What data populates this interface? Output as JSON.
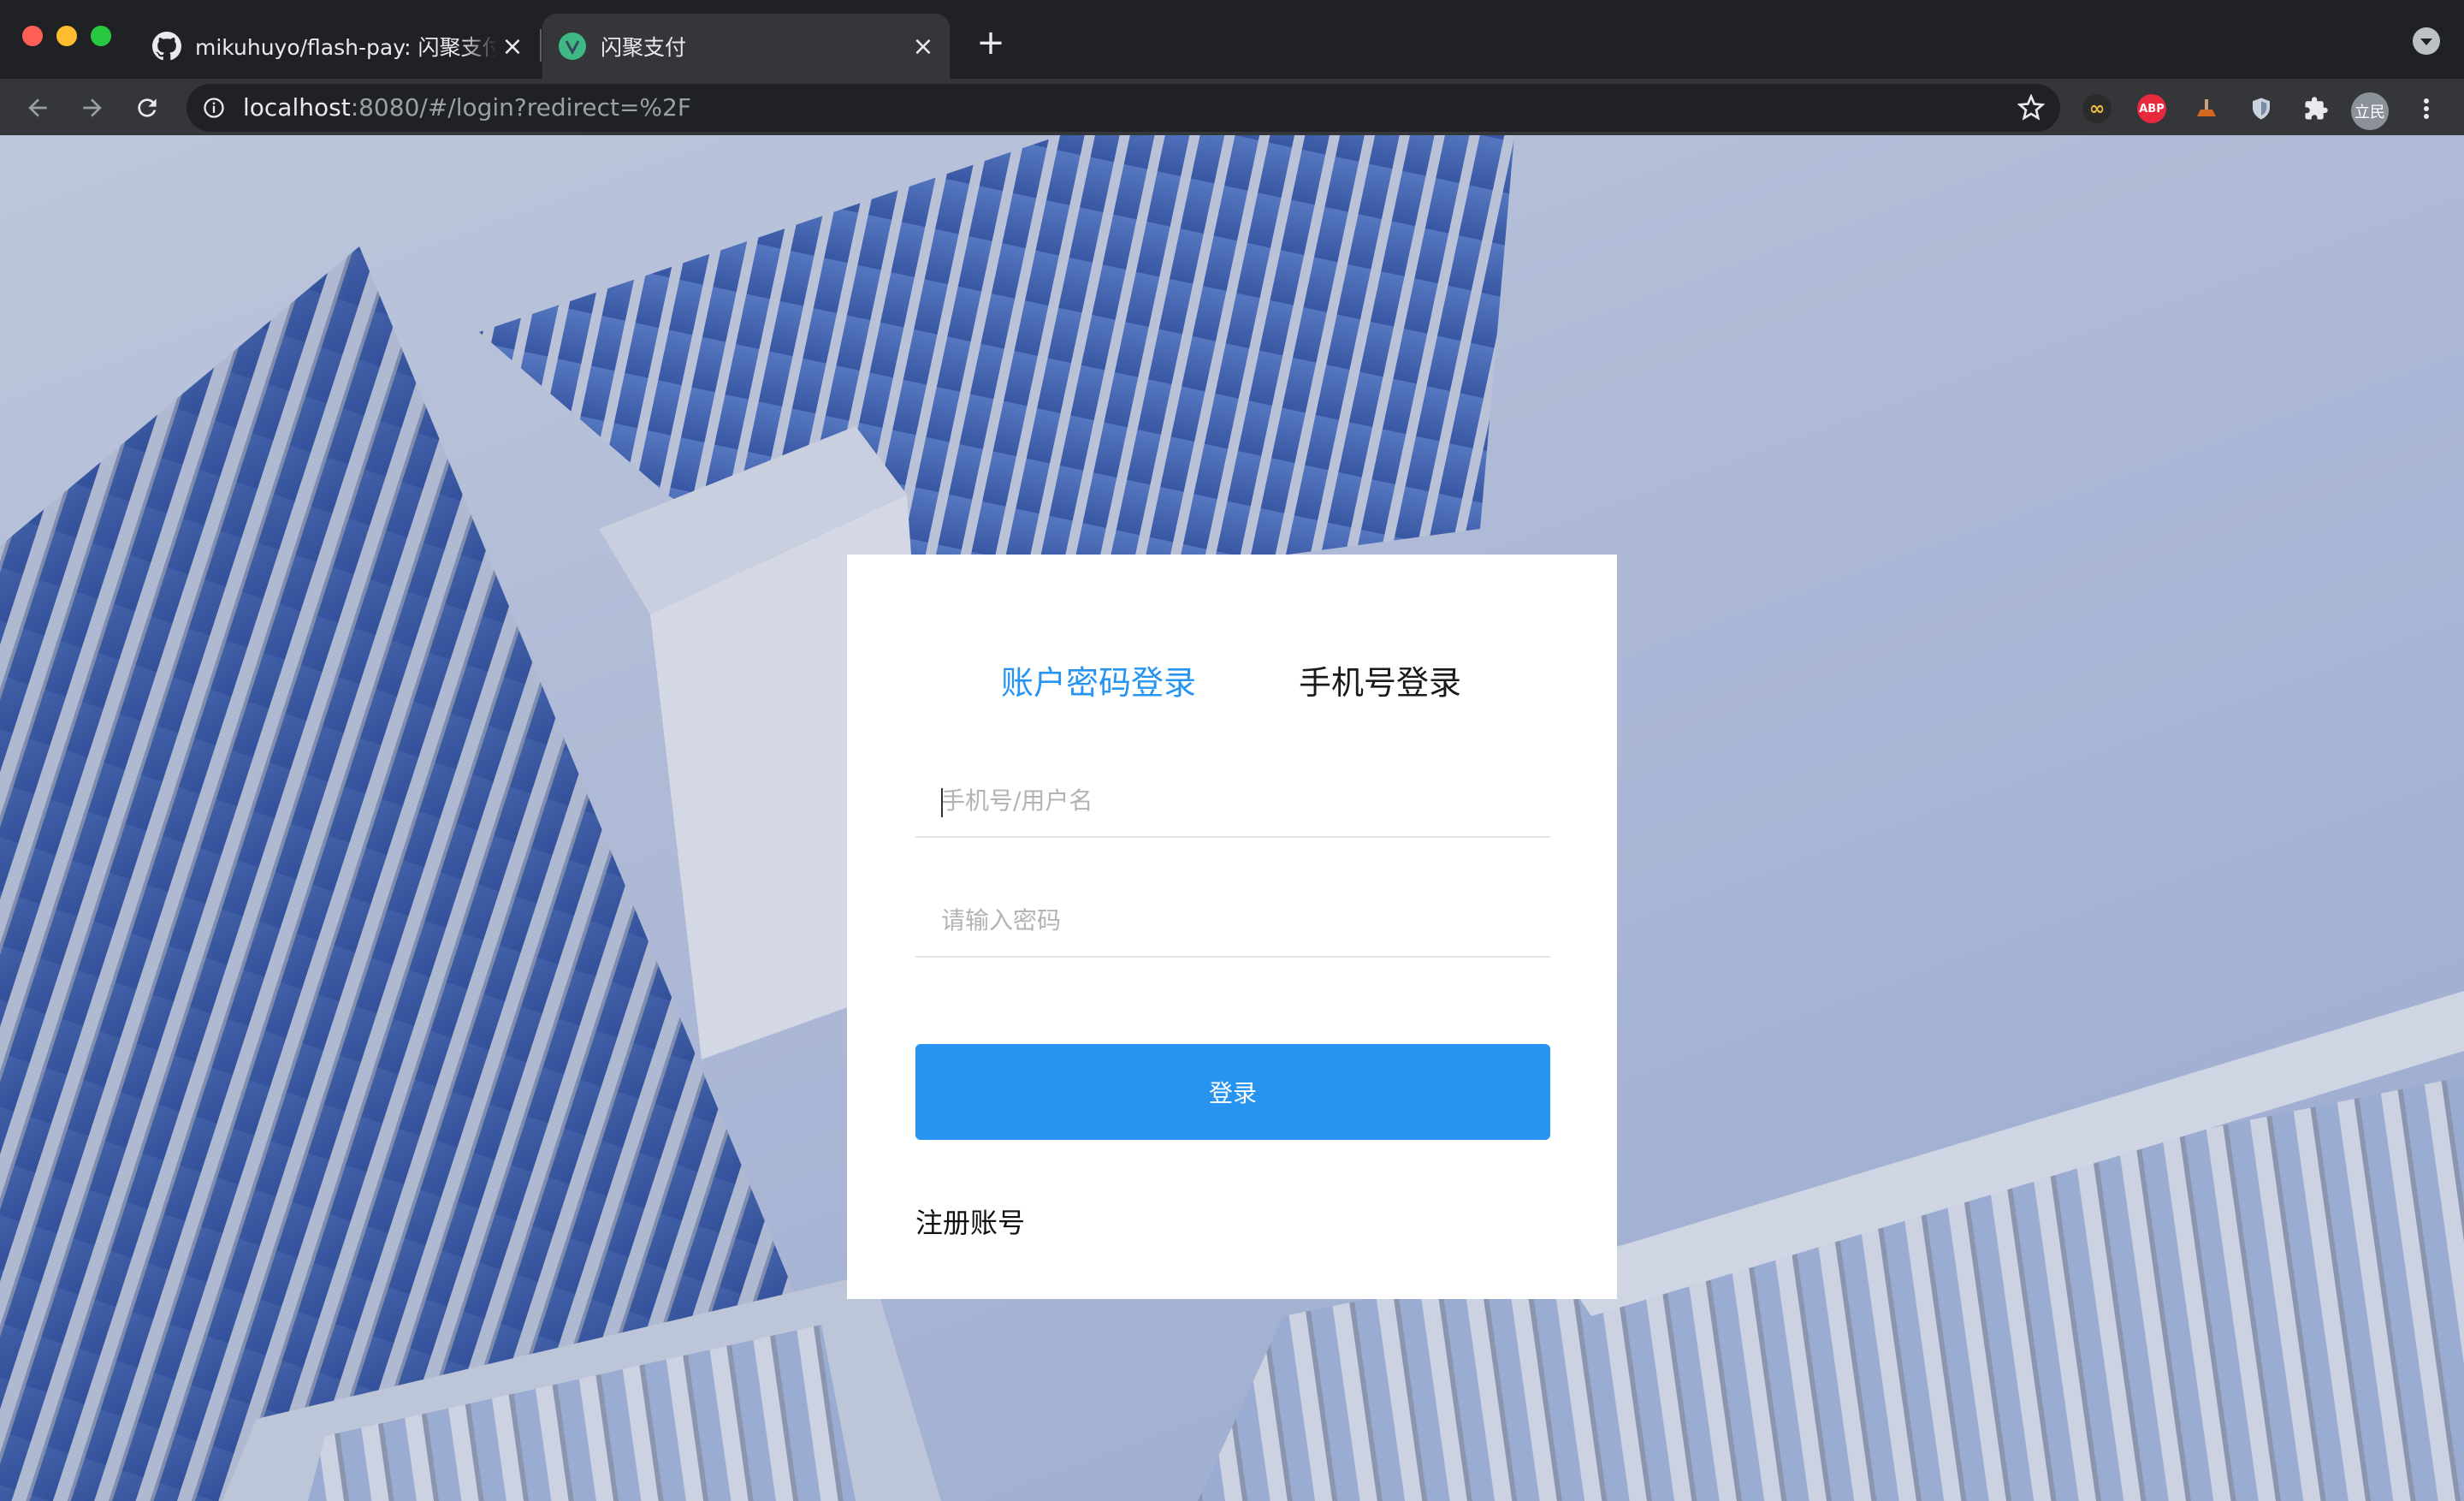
{
  "browser": {
    "tabs": [
      {
        "title": "mikuhuyo/flash-pay: 闪聚支付是",
        "icon": "github-icon",
        "active": false
      },
      {
        "title": "闪聚支付",
        "icon": "vue-favicon-icon",
        "active": true
      }
    ],
    "new_tab_label": "+",
    "url_host": "localhost",
    "url_rest": ":8080/#/login?redirect=%2F",
    "extensions": [
      {
        "name": "infinity-extension-icon",
        "label": "∞"
      },
      {
        "name": "adblock-plus-icon",
        "label": "ABP"
      },
      {
        "name": "extension-icon"
      },
      {
        "name": "shield-extension-icon"
      },
      {
        "name": "puzzle-extensions-icon"
      }
    ],
    "profile_label": "立民"
  },
  "login": {
    "tab_account": "账户密码登录",
    "tab_phone": "手机号登录",
    "active_tab": "account",
    "username_placeholder": "手机号/用户名",
    "username_value": "",
    "password_placeholder": "请输入密码",
    "password_value": "",
    "submit_label": "登录",
    "register_label": "注册账号"
  },
  "colors": {
    "accent": "#2794f2",
    "card_bg": "#ffffff",
    "browser_frame": "#202124",
    "toolbar": "#35363a"
  }
}
